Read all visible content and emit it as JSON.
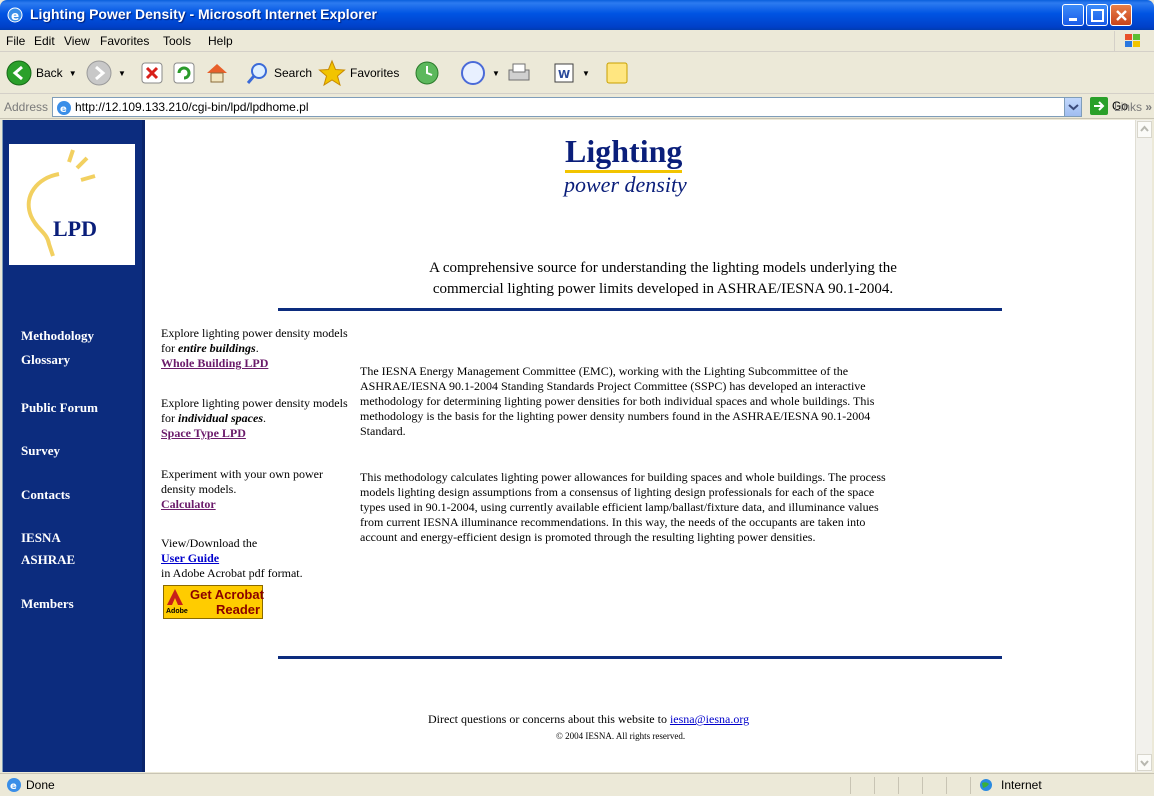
{
  "window": {
    "title": "Lighting Power Density - Microsoft Internet Explorer"
  },
  "menu": [
    "File",
    "Edit",
    "View",
    "Favorites",
    "Tools",
    "Help"
  ],
  "toolbar": {
    "back": "Back",
    "search": "Search",
    "favorites": "Favorites"
  },
  "address": {
    "label": "Address",
    "url": "http://12.109.133.210/cgi-bin/lpd/lpdhome.pl",
    "go": "Go",
    "links": "Links"
  },
  "logo": {
    "text": "LPD"
  },
  "nav": [
    "Methodology",
    "Glossary",
    "Public Forum",
    "Survey",
    "Contacts",
    "IESNA",
    "ASHRAE",
    "Members"
  ],
  "brand": {
    "main": "Lighting",
    "sub": "power density"
  },
  "tagline": {
    "line1": "A comprehensive source for understanding the lighting models underlying the",
    "line2": "commercial lighting power limits developed in ASHRAE/IESNA 90.1-2004."
  },
  "left": {
    "whole": {
      "prefix": "Explore lighting power density models for ",
      "emph": "entire buildings",
      "suffix": ".",
      "link": "Whole Building LPD"
    },
    "space": {
      "prefix": "Explore lighting power density models for ",
      "emph": "individual spaces",
      "suffix": ".",
      "link": "Space Type LPD"
    },
    "calc": {
      "text": "Experiment with your own power density models.",
      "link": "Calculator"
    },
    "guide": {
      "before": "View/Download the",
      "link": "User Guide",
      "after": "in Adobe Acrobat pdf format."
    },
    "acrobat": {
      "line1": "Get Acrobat",
      "line2": "Reader",
      "brand": "Adobe"
    }
  },
  "body": {
    "p1": "The IESNA Energy Management Committee (EMC), working with the Lighting Subcommittee of the ASHRAE/IESNA 90.1-2004 Standing Standards Project Committee (SSPC) has developed an interactive methodology for determining lighting power densities for both individual spaces and whole buildings. This methodology is the basis for the lighting power density numbers found in the ASHRAE/IESNA 90.1-2004 Standard.",
    "p2": "This methodology calculates lighting power allowances for building spaces and whole buildings. The process models lighting design assumptions from a consensus of lighting design professionals for each of the space types used in 90.1-2004, using currently available efficient lamp/ballast/fixture data, and illuminance values from current IESNA illuminance recommendations. In this way, the needs of the occupants are taken into account and energy-efficient design is promoted through the resulting lighting power densities."
  },
  "footer": {
    "text": "Direct questions or concerns about this website to ",
    "email": "iesna@iesna.org",
    "copyright": "© 2004 IESNA. All rights reserved."
  },
  "status": {
    "left": "Done",
    "zone": "Internet"
  }
}
